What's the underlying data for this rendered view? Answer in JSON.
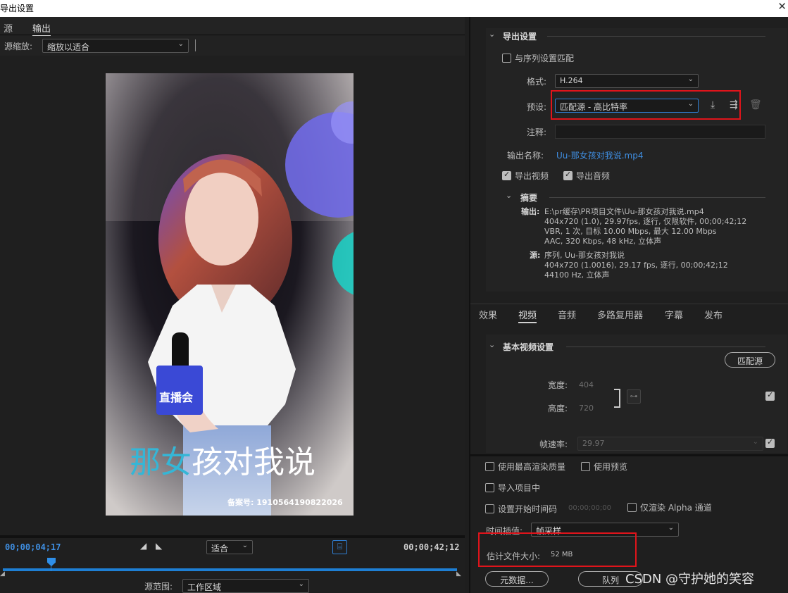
{
  "window": {
    "title": "导出设置"
  },
  "left_panel": {
    "tabs": [
      {
        "label": "源"
      },
      {
        "label": "输出"
      }
    ],
    "source_zoom_label": "源缩放:",
    "source_zoom_value": "缩放以适合",
    "preview": {
      "caption_part1": "那女",
      "caption_part2": "孩对我说",
      "record_no": "备案号: 1910564190822026",
      "mic_label": "直播会"
    },
    "timecode_current": "00;00;04;17",
    "timecode_end": "00;00;42;12",
    "fit_value": "适合",
    "source_range_label": "源范围:",
    "source_range_value": "工作区域"
  },
  "export_settings": {
    "section_title": "导出设置",
    "match_sequence_label": "与序列设置匹配",
    "format_label": "格式:",
    "format_value": "H.264",
    "preset_label": "预设:",
    "preset_value": "匹配源 - 高比特率",
    "comments_label": "注释:",
    "comments_value": "",
    "output_name_label": "输出名称:",
    "output_name_value": "Uu-那女孩对我说.mp4",
    "export_video_label": "导出视频",
    "export_audio_label": "导出音频",
    "summary_title": "摘要",
    "output_key": "输出:",
    "output_lines": [
      "E:\\pr缓存\\PR项目文件\\Uu-那女孩对我说.mp4",
      "404x720 (1.0), 29.97fps, 逐行, 仅限软件, 00;00;42;12",
      "VBR, 1 次, 目标 10.00 Mbps, 最大 12.00 Mbps",
      "AAC, 320 Kbps, 48  kHz, 立体声"
    ],
    "source_key": "源:",
    "source_lines": [
      "序列, Uu-那女孩对我说",
      "404x720  (1.0016), 29.17 fps, 逐行, 00;00;42;12",
      "44100 Hz, 立体声"
    ]
  },
  "settings_tabs": [
    {
      "label": "效果"
    },
    {
      "label": "视频"
    },
    {
      "label": "音频"
    },
    {
      "label": "多路复用器"
    },
    {
      "label": "字幕"
    },
    {
      "label": "发布"
    }
  ],
  "basic_video": {
    "section_title": "基本视频设置",
    "match_source_button": "匹配源",
    "width_label": "宽度:",
    "width_value": "404",
    "height_label": "高度:",
    "height_value": "720",
    "framerate_label": "帧速率:",
    "framerate_value": "29.97"
  },
  "bottom_options": {
    "max_render_quality": "使用最高渲染质量",
    "use_previews": "使用预览",
    "import_into_project": "导入项目中",
    "set_start_timecode": "设置开始时间码",
    "start_timecode_value": "00;00;00;00",
    "render_alpha_only": "仅渲染 Alpha 通道",
    "time_interpolation_label": "时间插值:",
    "time_interpolation_value": "帧采样",
    "estimated_file_size_label": "估计文件大小:",
    "estimated_file_size_value": "52 MB",
    "metadata_button": "元数据...",
    "queue_button": "队列",
    "watermark": "CSDN @守护她的笑容"
  }
}
